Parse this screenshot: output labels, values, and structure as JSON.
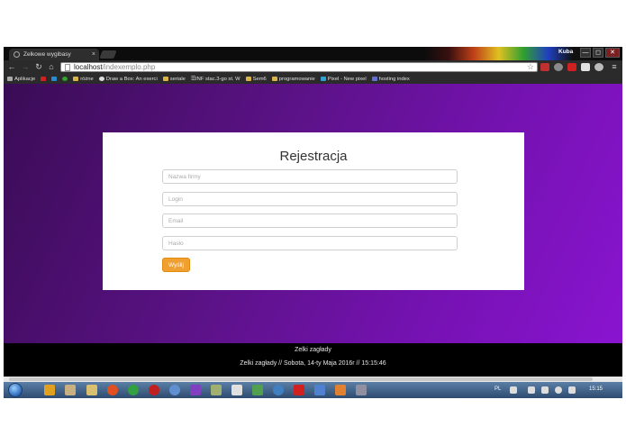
{
  "browser": {
    "tab_title": "Zelkowe wygibasy",
    "tab_close": "×",
    "user_name": "Kuba",
    "window_buttons": {
      "minimize": "—",
      "maximize": "◻",
      "close": "✕"
    },
    "url_host": "localhost",
    "url_path": "/indexemplo.php"
  },
  "bookmarks": [
    "Aplikacje",
    "różne",
    "Draw a Box: An exerci",
    "seriale",
    "☰INF stac.3-go st. W",
    "Sem6",
    "programowanie",
    "Pixel - New pixel",
    "hosting index"
  ],
  "form": {
    "title": "Rejestracja",
    "company_placeholder": "Nazwa firmy",
    "login_placeholder": "Login",
    "email_placeholder": "Email",
    "password_placeholder": "Hasło",
    "submit_label": "Wyślij",
    "accent": "#f0a030"
  },
  "footer": {
    "line1": "Zelki zagłady",
    "line2": "Zelki zagłady // Sobota, 14-ty Maja 2016r // 15:15:46"
  },
  "taskbar": {
    "language": "PL",
    "clock": "15:15"
  },
  "colors": {
    "background_start": "#3a0c55",
    "background_end": "#8a14d0"
  }
}
